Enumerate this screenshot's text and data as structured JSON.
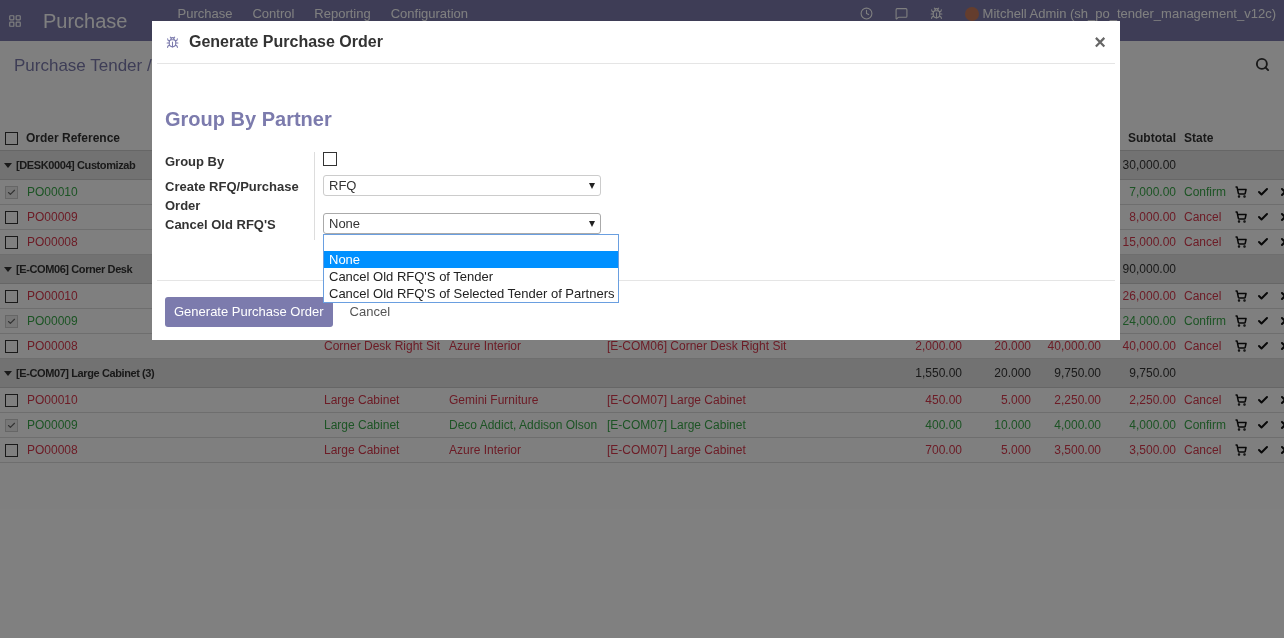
{
  "navbar": {
    "app_title": "Purchase",
    "menu": [
      "Purchase",
      "Control",
      "Reporting",
      "Configuration"
    ],
    "user": "Mitchell Admin (sh_po_tender_management_v12c)"
  },
  "breadcrumb": "Purchase Tender /",
  "table": {
    "all_selected": false,
    "columns": [
      "Order Reference",
      "Subtotal",
      "State"
    ],
    "groups": [
      {
        "label": "[DESK0004] Customizab",
        "expanded": true,
        "subtotal": "30,000.00",
        "rows": [
          {
            "selected": true,
            "kind": "confirm",
            "reference": "PO00010",
            "subtotal": "7,000.00",
            "state": "Confirm"
          },
          {
            "selected": false,
            "kind": "cancel",
            "reference": "PO00009",
            "subtotal": "8,000.00",
            "state": "Cancel"
          },
          {
            "selected": false,
            "kind": "cancel",
            "reference": "PO00008",
            "subtotal": "15,000.00",
            "state": "Cancel"
          }
        ]
      },
      {
        "label": "[E-COM06] Corner Desk",
        "expanded": true,
        "subtotal": "90,000.00",
        "rows": [
          {
            "selected": false,
            "kind": "cancel",
            "reference": "PO00010",
            "subtotal": "26,000.00",
            "state": "Cancel"
          },
          {
            "selected": true,
            "kind": "confirm",
            "reference": "PO00009",
            "subtotal": "24,000.00",
            "state": "Confirm"
          },
          {
            "selected": false,
            "kind": "cancel",
            "reference": "PO00008",
            "product": "Corner Desk Right Sit",
            "vendor": "Azure Interior",
            "description": "[E-COM06] Corner Desk Right Sit",
            "price": "2,000.00",
            "qty": "20.000",
            "amount": "40,000.00",
            "subtotal": "40,000.00",
            "state": "Cancel"
          }
        ]
      },
      {
        "label": "[E-COM07] Large Cabinet (3)",
        "expanded": true,
        "price": "1,550.00",
        "qty": "20.000",
        "amount": "9,750.00",
        "subtotal": "9,750.00",
        "rows": [
          {
            "selected": false,
            "kind": "cancel",
            "reference": "PO00010",
            "product": "Large Cabinet",
            "vendor": "Gemini Furniture",
            "description": "[E-COM07] Large Cabinet",
            "price": "450.00",
            "qty": "5.000",
            "amount": "2,250.00",
            "subtotal": "2,250.00",
            "state": "Cancel"
          },
          {
            "selected": true,
            "kind": "confirm",
            "reference": "PO00009",
            "product": "Large Cabinet",
            "vendor": "Deco Addict, Addison Olson",
            "description": "[E-COM07] Large Cabinet",
            "price": "400.00",
            "qty": "10.000",
            "amount": "4,000.00",
            "subtotal": "4,000.00",
            "state": "Confirm"
          },
          {
            "selected": false,
            "kind": "cancel",
            "reference": "PO00008",
            "product": "Large Cabinet",
            "vendor": "Azure Interior",
            "description": "[E-COM07] Large Cabinet",
            "price": "700.00",
            "qty": "5.000",
            "amount": "3,500.00",
            "subtotal": "3,500.00",
            "state": "Cancel"
          }
        ]
      }
    ]
  },
  "modal": {
    "title": "Generate Purchase Order",
    "close": "×",
    "heading": "Group By Partner",
    "fields": [
      {
        "kind": "checkbox",
        "label": "Group By",
        "checked": false
      },
      {
        "kind": "select",
        "label": "Create RFQ/Purchase Order",
        "value": "RFQ",
        "expanded": false
      },
      {
        "kind": "select",
        "label": "Cancel Old RFQ'S",
        "value": "None",
        "expanded": true,
        "options": [
          {
            "label": "None",
            "selected": true
          },
          {
            "label": "Cancel Old RFQ'S of Tender",
            "selected": false
          },
          {
            "label": "Cancel Old RFQ'S of Selected Tender of Partners",
            "selected": false
          }
        ]
      }
    ],
    "buttons": [
      {
        "label": "Generate Purchase Order",
        "kind": "primary"
      },
      {
        "label": "Cancel",
        "kind": "link"
      }
    ]
  }
}
